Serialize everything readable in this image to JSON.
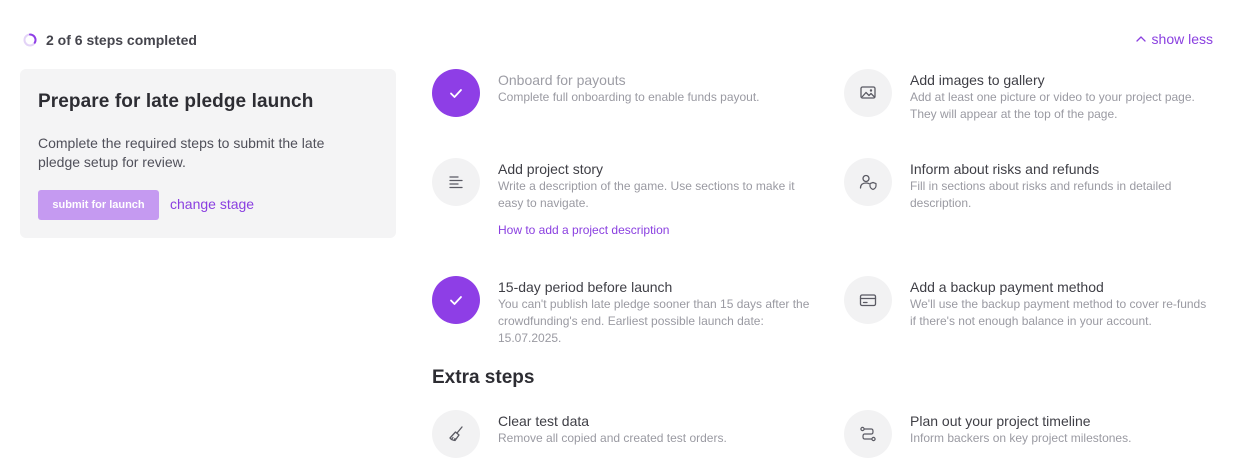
{
  "progress": {
    "text": "2 of 6 steps completed",
    "completed": 2,
    "total": 6
  },
  "header": {
    "show_less": "show less"
  },
  "card": {
    "title": "Prepare for late pledge launch",
    "description": "Complete the required steps to submit the late pledge setup for review.",
    "submit_label": "submit for launch",
    "change_stage_label": "change stage"
  },
  "steps": [
    {
      "title": "Onboard for payouts",
      "description": "Complete full onboarding to enable funds payout.",
      "done": true,
      "icon": "check-icon"
    },
    {
      "title": "Add images to gallery",
      "description": "Add at least one picture or video to your project page. They will appear at the top of the page.",
      "done": false,
      "icon": "image-icon"
    },
    {
      "title": "Add project story",
      "description": "Write a description of the game. Use sections to make it easy to navigate.",
      "link": "How to add a project description",
      "done": false,
      "icon": "text-lines-icon"
    },
    {
      "title": "Inform about risks and refunds",
      "description": "Fill in sections about risks and refunds in detailed description.",
      "done": false,
      "icon": "user-shield-icon"
    },
    {
      "title": "15-day period before launch",
      "description": "You can't publish late pledge sooner than 15 days after the crowdfunding's end. Earliest possible launch date: 15.07.2025.",
      "done": true,
      "icon": "check-icon"
    },
    {
      "title": "Add a backup payment method",
      "description": "We'll use the backup payment method to cover re-funds if there's not enough balance in your account.",
      "done": false,
      "icon": "credit-card-icon"
    }
  ],
  "extra": {
    "heading": "Extra steps",
    "steps": [
      {
        "title": "Clear test data",
        "description": "Remove all copied and created test orders.",
        "icon": "broom-icon"
      },
      {
        "title": "Plan out your project timeline",
        "description": "Inform backers on key project milestones.",
        "icon": "route-icon"
      }
    ]
  },
  "colors": {
    "accent": "#8e3ee6",
    "accent_light": "#c59af1",
    "link": "#8a3fe0",
    "card_bg": "#f4f4f5"
  }
}
